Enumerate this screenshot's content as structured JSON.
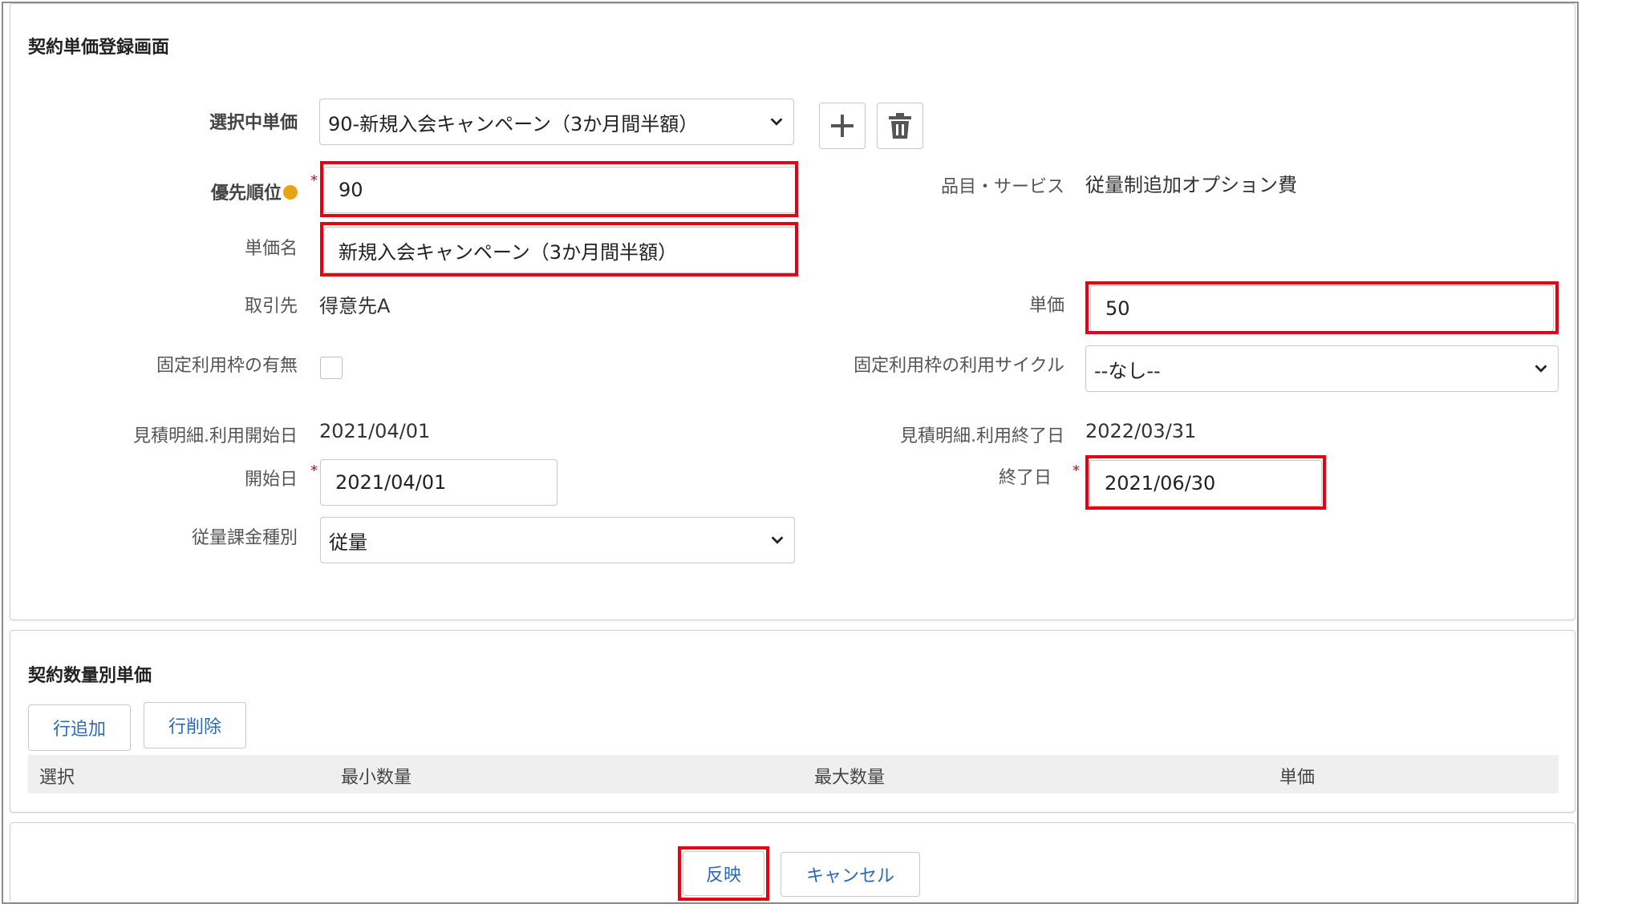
{
  "form": {
    "title": "契約単価登録画面",
    "selected_price_label": "選択中単価",
    "selected_price_value": "90-新規入会キャンペーン（3か月間半額）",
    "priority_label": "優先順位",
    "priority_value": "90",
    "price_name_label": "単価名",
    "price_name_value": "新規入会キャンペーン（3か月間半額）",
    "customer_label": "取引先",
    "customer_value": "得意先A",
    "fixed_usage_label": "固定利用枠の有無",
    "estimate_start_label": "見積明細.利用開始日",
    "estimate_start_value": "2021/04/01",
    "start_date_label": "開始日",
    "start_date_value": "2021/04/01",
    "billing_type_label": "従量課金種別",
    "billing_type_value": "従量",
    "product_label": "品目・サービス",
    "product_value": "従量制追加オプション費",
    "unit_price_label": "単価",
    "unit_price_value": "50",
    "cycle_label": "固定利用枠の利用サイクル",
    "cycle_value": "--なし--",
    "estimate_end_label": "見積明細.利用終了日",
    "estimate_end_value": "2022/03/31",
    "end_date_label": "終了日",
    "end_date_value": "2021/06/30",
    "required_mark": "*"
  },
  "quantity": {
    "title": "契約数量別単価",
    "add_row_label": "行追加",
    "delete_row_label": "行削除",
    "columns": [
      "選択",
      "最小数量",
      "最大数量",
      "単価"
    ]
  },
  "footer": {
    "apply_label": "反映",
    "cancel_label": "キャンセル"
  },
  "colors": {
    "highlight": "#e60012",
    "link_blue": "#2a6ab6",
    "required": "#d0021b",
    "help_icon": "#e8a317"
  },
  "icons": [
    "plus-icon",
    "trash-icon",
    "chevron-down-icon",
    "help-icon"
  ]
}
